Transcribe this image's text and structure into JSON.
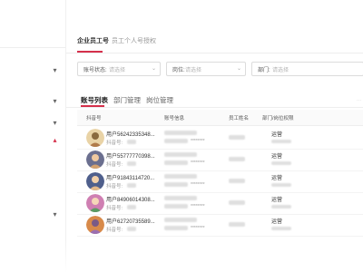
{
  "top_tabs": [
    {
      "label": "企业员工号"
    },
    {
      "label": "员工个人号授权"
    }
  ],
  "filters": [
    {
      "label": "账号状态:",
      "placeholder": "请选择"
    },
    {
      "label": "岗位:",
      "placeholder": "请选择"
    },
    {
      "label": "部门:",
      "placeholder": "请选择"
    }
  ],
  "sub_tabs": [
    {
      "label": "账号列表"
    },
    {
      "label": "部门管理"
    },
    {
      "label": "岗位管理"
    }
  ],
  "table": {
    "headers": [
      "抖音号",
      "账号信息",
      "员工姓名",
      "部门/岗位权限"
    ],
    "rows": [
      {
        "name": "用户56242335348...",
        "sub": "抖音号:",
        "dots": "********",
        "role": "运营"
      },
      {
        "name": "用户55777770398...",
        "sub": "抖音号:",
        "dots": "********",
        "role": "运营"
      },
      {
        "name": "用户91843114720...",
        "sub": "抖音号:",
        "dots": "********",
        "role": "运营"
      },
      {
        "name": "用户84906014308...",
        "sub": "抖音号:",
        "dots": "********",
        "role": "运营"
      },
      {
        "name": "用户62720735589...",
        "sub": "抖音号:",
        "dots": "********",
        "role": "运营"
      }
    ]
  },
  "colors": {
    "accent": "#d5304b"
  },
  "icons": [
    "chevron-down-icon",
    "chevron-up-icon",
    "dropdown-arrow-icon",
    "avatar"
  ]
}
